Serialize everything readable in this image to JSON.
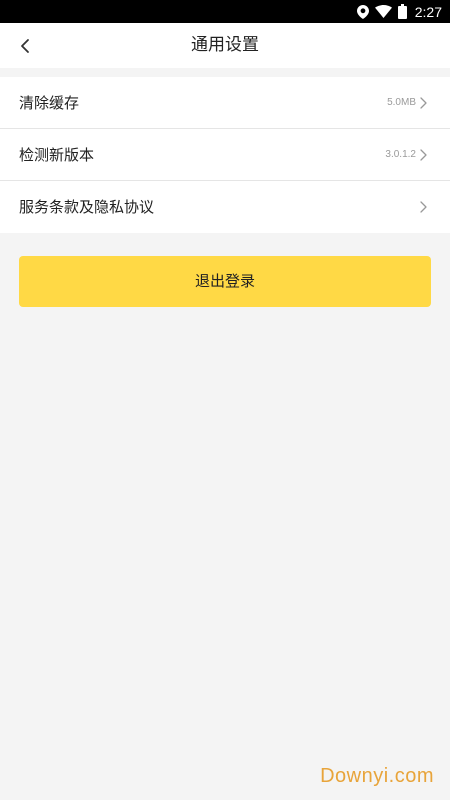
{
  "status_bar": {
    "time": "2:27",
    "icons": [
      "location-icon",
      "wifi-icon",
      "battery-icon"
    ]
  },
  "header": {
    "title": "通用设置",
    "back_icon": "back-arrow-icon"
  },
  "settings": {
    "items": [
      {
        "label": "清除缓存",
        "value": "5.0MB"
      },
      {
        "label": "检测新版本",
        "value": "3.0.1.2"
      },
      {
        "label": "服务条款及隐私协议",
        "value": ""
      }
    ]
  },
  "actions": {
    "logout_label": "退出登录"
  },
  "watermark": {
    "text": "Downyi.com"
  },
  "colors": {
    "accent": "#ffd945",
    "background": "#f4f4f4",
    "watermark": "#e8a43a"
  }
}
